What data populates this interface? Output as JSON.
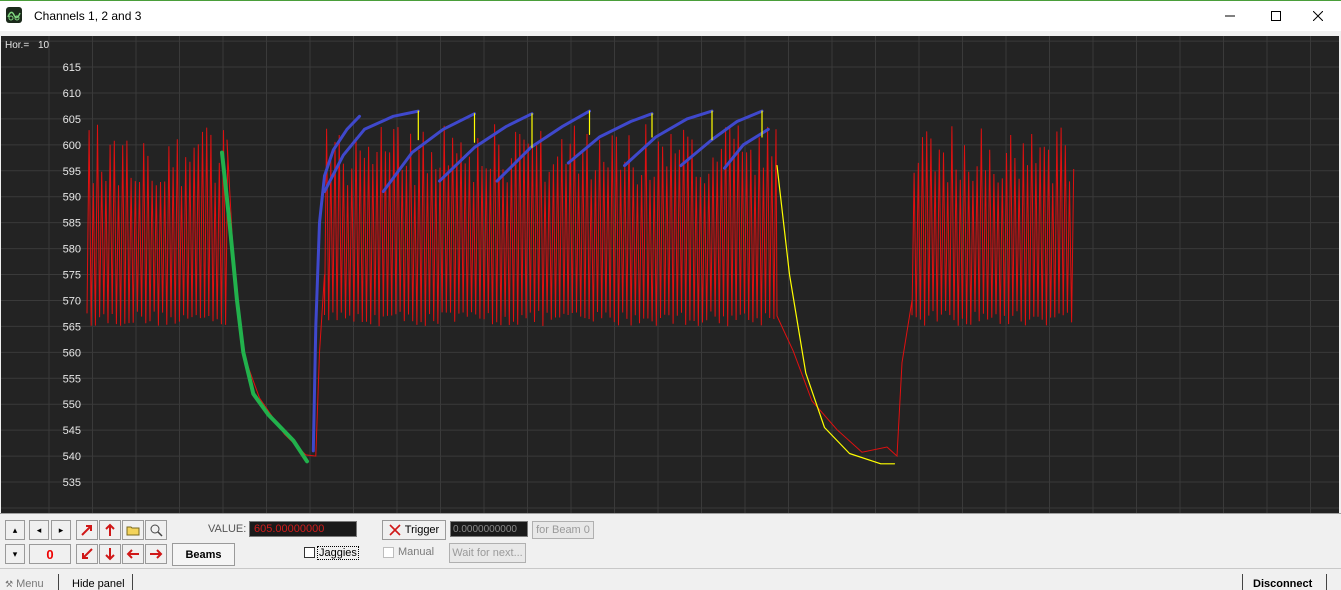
{
  "window": {
    "title": "Channels 1, 2 and 3"
  },
  "plot": {
    "hor_label": "Hor.=",
    "hor_value": "10",
    "y_ticks": [
      "615",
      "610",
      "605",
      "600",
      "595",
      "590",
      "585",
      "580",
      "575",
      "570",
      "565",
      "560",
      "555",
      "550",
      "545",
      "540",
      "535"
    ]
  },
  "controls": {
    "counter_value": "0",
    "beams_label": "Beams",
    "value_label": "VALUE:",
    "value_field": "605.00000000",
    "jaggies_label": "Jaggies",
    "trigger_label": "Trigger",
    "trigger_field": "0.0000000000",
    "for_beam_label": "for Beam 0",
    "manual_label": "Manual",
    "wait_label": "Wait for next..."
  },
  "footer": {
    "menu_label": "Menu",
    "hide_panel_label": "Hide panel",
    "disconnect_label": "Disconnect"
  },
  "colors": {
    "signal": "#e01010",
    "green_fit": "#22b14c",
    "blue_fit": "#3f48cc",
    "yellow_fit": "#ffff00",
    "background": "#232323"
  },
  "chart_data": {
    "type": "line",
    "y_range": [
      532,
      618
    ],
    "series": [
      {
        "segments": [
          {
            "kind": "osc",
            "x0": 0.0,
            "x1": 0.112,
            "min": 565,
            "max": 604
          },
          {
            "kind": "decay",
            "points": [
              [
                0.112,
                601
              ],
              [
                0.118,
                575
              ],
              [
                0.125,
                560
              ],
              [
                0.138,
                552
              ],
              [
                0.158,
                545
              ],
              [
                0.175,
                540
              ],
              [
                0.183,
                540
              ]
            ]
          },
          {
            "kind": "rise",
            "points": [
              [
                0.183,
                540
              ],
              [
                0.186,
                560
              ],
              [
                0.19,
                575
              ]
            ]
          },
          {
            "kind": "osc",
            "x0": 0.19,
            "x1": 0.552,
            "min": 565,
            "max": 604
          },
          {
            "kind": "decay",
            "points": [
              [
                0.552,
                567
              ],
              [
                0.565,
                560
              ],
              [
                0.58,
                552
              ],
              [
                0.6,
                546
              ],
              [
                0.62,
                542
              ],
              [
                0.64,
                541
              ],
              [
                0.648,
                540
              ]
            ]
          },
          {
            "kind": "rise",
            "points": [
              [
                0.648,
                540
              ],
              [
                0.652,
                558
              ],
              [
                0.66,
                570
              ]
            ]
          },
          {
            "kind": "osc",
            "x0": 0.66,
            "x1": 0.788,
            "min": 565,
            "max": 604
          }
        ]
      }
    ],
    "overlays": [
      {
        "color": "green",
        "points": [
          [
            0.108,
            598.5
          ],
          [
            0.114,
            585
          ],
          [
            0.12,
            570
          ],
          [
            0.125,
            560
          ],
          [
            0.133,
            552
          ],
          [
            0.145,
            548
          ],
          [
            0.165,
            543
          ],
          [
            0.176,
            539
          ]
        ]
      },
      {
        "color": "blue",
        "points": [
          [
            0.181,
            541
          ],
          [
            0.183,
            565
          ],
          [
            0.186,
            585
          ],
          [
            0.19,
            594
          ],
          [
            0.197,
            599
          ],
          [
            0.208,
            603
          ],
          [
            0.218,
            605.5
          ]
        ]
      },
      {
        "color": "blue",
        "points": [
          [
            0.19,
            591
          ],
          [
            0.205,
            598
          ],
          [
            0.222,
            603
          ],
          [
            0.245,
            605.5
          ],
          [
            0.265,
            606.5
          ]
        ]
      },
      {
        "color": "blue",
        "points": [
          [
            0.237,
            591
          ],
          [
            0.26,
            598.5
          ],
          [
            0.285,
            603
          ],
          [
            0.31,
            606
          ]
        ]
      },
      {
        "color": "blue",
        "points": [
          [
            0.282,
            593
          ],
          [
            0.31,
            599.5
          ],
          [
            0.335,
            603.5
          ],
          [
            0.356,
            606
          ]
        ]
      },
      {
        "color": "blue",
        "points": [
          [
            0.328,
            593
          ],
          [
            0.355,
            599.5
          ],
          [
            0.38,
            603.5
          ],
          [
            0.402,
            606.5
          ]
        ]
      },
      {
        "color": "blue",
        "points": [
          [
            0.385,
            596.5
          ],
          [
            0.41,
            601.5
          ],
          [
            0.435,
            604.5
          ],
          [
            0.452,
            606
          ]
        ]
      },
      {
        "color": "blue",
        "points": [
          [
            0.43,
            596
          ],
          [
            0.455,
            601.5
          ],
          [
            0.48,
            605
          ],
          [
            0.5,
            606.5
          ]
        ]
      },
      {
        "color": "blue",
        "points": [
          [
            0.475,
            596
          ],
          [
            0.5,
            601
          ],
          [
            0.52,
            604.5
          ],
          [
            0.54,
            606.5
          ]
        ]
      },
      {
        "color": "blue",
        "points": [
          [
            0.51,
            595.5
          ],
          [
            0.525,
            600
          ],
          [
            0.545,
            603
          ]
        ]
      },
      {
        "color": "yellow",
        "points": [
          [
            0.265,
            606.5
          ],
          [
            0.265,
            601
          ]
        ]
      },
      {
        "color": "yellow",
        "points": [
          [
            0.31,
            606
          ],
          [
            0.31,
            600.5
          ]
        ]
      },
      {
        "color": "yellow",
        "points": [
          [
            0.356,
            606
          ],
          [
            0.356,
            599.5
          ]
        ]
      },
      {
        "color": "yellow",
        "points": [
          [
            0.402,
            606.5
          ],
          [
            0.402,
            602
          ]
        ]
      },
      {
        "color": "yellow",
        "points": [
          [
            0.452,
            606
          ],
          [
            0.452,
            601.5
          ]
        ]
      },
      {
        "color": "yellow",
        "points": [
          [
            0.5,
            606.5
          ],
          [
            0.5,
            601
          ]
        ]
      },
      {
        "color": "yellow",
        "points": [
          [
            0.54,
            606.5
          ],
          [
            0.54,
            601.5
          ]
        ]
      },
      {
        "color": "yellow",
        "points": [
          [
            0.552,
            596
          ],
          [
            0.562,
            575
          ],
          [
            0.575,
            556
          ],
          [
            0.59,
            545.5
          ],
          [
            0.61,
            540.5
          ],
          [
            0.635,
            538.5
          ],
          [
            0.646,
            538.5
          ]
        ]
      }
    ]
  }
}
